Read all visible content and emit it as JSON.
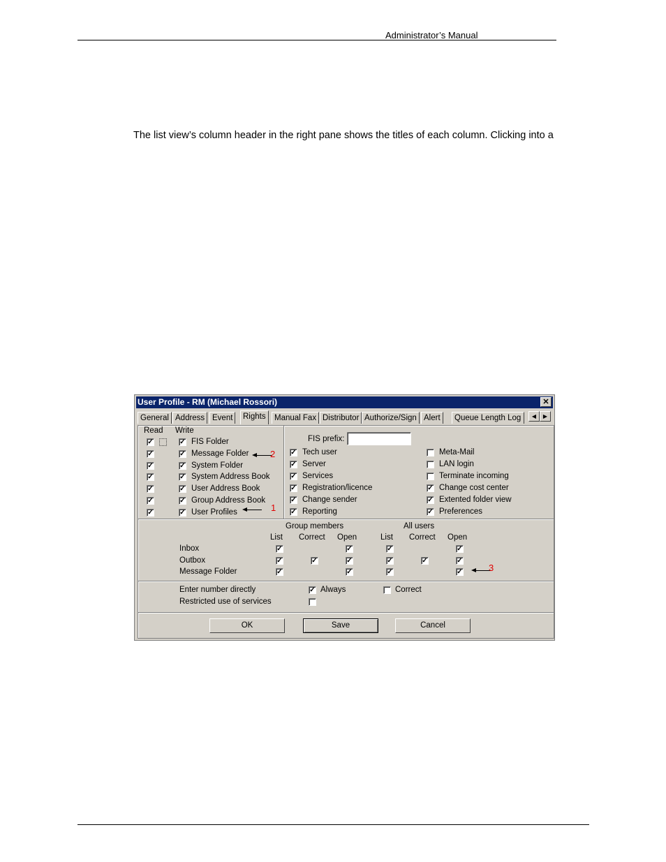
{
  "page": {
    "header": "Administrator’s Manual",
    "paragraph": "The list view’s column header in the right pane shows the titles of each column. Clicking into a"
  },
  "dialog": {
    "title": "User Profile - RM (Michael Rossori)",
    "close_icon": "close-icon",
    "tabs": [
      {
        "label": "General",
        "active": false
      },
      {
        "label": "Address",
        "active": false
      },
      {
        "label": "Event",
        "active": false
      },
      {
        "label": "Rights",
        "active": true
      },
      {
        "label": "Manual Fax",
        "active": false
      },
      {
        "label": "Distributor",
        "active": false
      },
      {
        "label": "Authorize/Sign",
        "active": false
      },
      {
        "label": "Alert",
        "active": false
      },
      {
        "label": "Queue Length Log",
        "active": false
      }
    ],
    "tab_scroll": {
      "left": "◀",
      "right": "▶"
    },
    "folders": {
      "read_header": "Read",
      "write_header": "Write",
      "items": [
        {
          "label": "FIS Folder",
          "read": true,
          "write": true
        },
        {
          "label": "Message Folder",
          "read": true,
          "write": true
        },
        {
          "label": "System Folder",
          "read": true,
          "write": true
        },
        {
          "label": "System Address Book",
          "read": true,
          "write": true
        },
        {
          "label": "User Address Book",
          "read": true,
          "write": true
        },
        {
          "label": "Group Address Book",
          "read": true,
          "write": true
        },
        {
          "label": "User Profiles",
          "read": true,
          "write": true
        }
      ]
    },
    "fis_prefix": {
      "label": "FIS prefix:",
      "value": ""
    },
    "rights_left": [
      {
        "label": "Tech user",
        "checked": true
      },
      {
        "label": "Server",
        "checked": true
      },
      {
        "label": "Services",
        "checked": true
      },
      {
        "label": "Registration/licence",
        "checked": true
      },
      {
        "label": "Change sender",
        "checked": true
      },
      {
        "label": "Reporting",
        "checked": true
      }
    ],
    "rights_right": [
      {
        "label": "Meta-Mail",
        "checked": false
      },
      {
        "label": "LAN login",
        "checked": false
      },
      {
        "label": "Terminate incoming",
        "checked": false
      },
      {
        "label": "Change cost center",
        "checked": true
      },
      {
        "label": "Extented folder view",
        "checked": true
      },
      {
        "label": "Preferences",
        "checked": true
      }
    ],
    "access": {
      "group_header": "Group members",
      "all_header": "All users",
      "columns": [
        "List",
        "Correct",
        "Open",
        "List",
        "Correct",
        "Open"
      ],
      "rows": [
        {
          "label": "Inbox",
          "values": [
            true,
            null,
            true,
            true,
            null,
            true
          ]
        },
        {
          "label": "Outbox",
          "values": [
            true,
            true,
            true,
            true,
            true,
            true
          ]
        },
        {
          "label": "Message Folder",
          "values": [
            true,
            null,
            true,
            true,
            null,
            true
          ]
        }
      ]
    },
    "options": {
      "enter_number_label": "Enter number directly",
      "always_label": "Always",
      "always_checked": true,
      "correct_label": "Correct",
      "correct_checked": false,
      "restricted_label": "Restricted use of services",
      "restricted_checked": false
    },
    "annotations": [
      "1",
      "2",
      "3"
    ],
    "buttons": {
      "ok": "OK",
      "save": "Save",
      "cancel": "Cancel"
    }
  }
}
